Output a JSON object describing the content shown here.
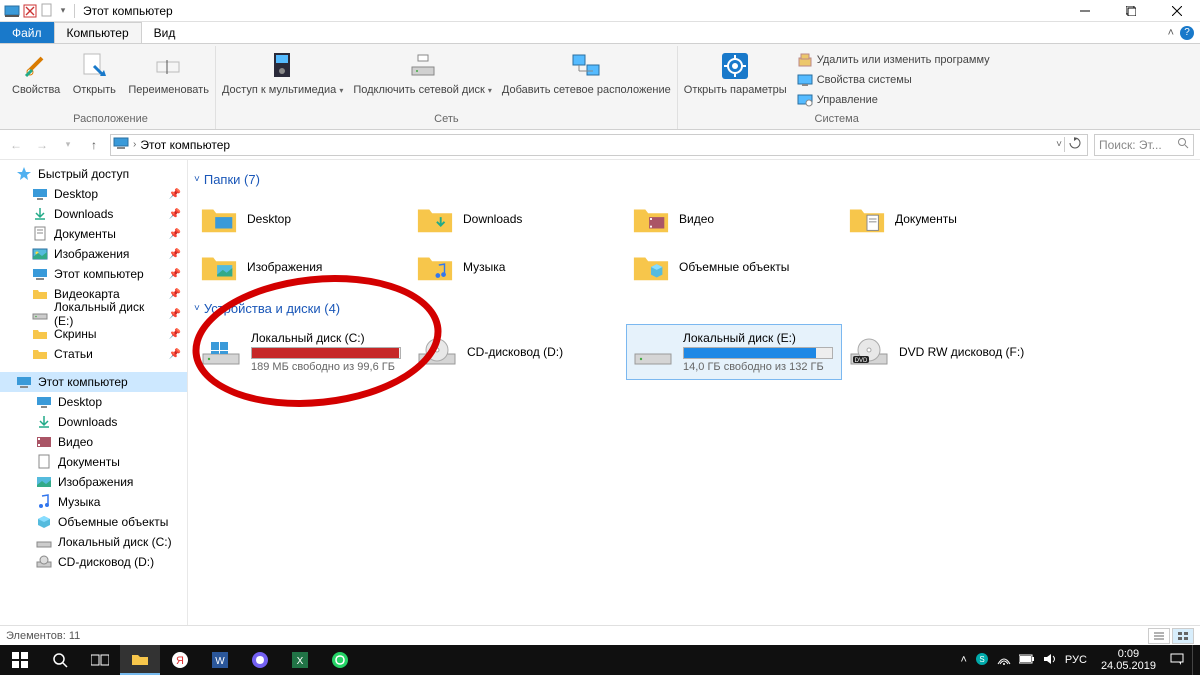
{
  "title": "Этот компьютер",
  "ribbon_tabs": {
    "file": "Файл",
    "computer": "Компьютер",
    "view": "Вид"
  },
  "ribbon": {
    "group1_label": "Расположение",
    "btn_properties": "Свойства",
    "btn_open": "Открыть",
    "btn_rename": "Переименовать",
    "group2_label": "Сеть",
    "btn_media": "Доступ к\nмультимедиа",
    "btn_mapdrive": "Подключить\nсетевой диск",
    "btn_addloc": "Добавить сетевое\nрасположение",
    "group3_label": "Система",
    "btn_settings": "Открыть\nпараметры",
    "btn_uninstall": "Удалить или изменить программу",
    "btn_sysprops": "Свойства системы",
    "btn_manage": "Управление"
  },
  "breadcrumb": "Этот компьютер",
  "search_placeholder": "Поиск: Эт...",
  "sidebar": {
    "quick": "Быстрый доступ",
    "desktop": "Desktop",
    "downloads": "Downloads",
    "documents": "Документы",
    "pictures": "Изображения",
    "this_pc": "Этот компьютер",
    "videocard": "Видеокарта",
    "local_e": "Локальный диск (E:)",
    "screens": "Скрины",
    "articles": "Статьи",
    "this_pc2": "Этот компьютер",
    "desktop2": "Desktop",
    "downloads2": "Downloads",
    "video": "Видео",
    "documents2": "Документы",
    "pictures2": "Изображения",
    "music": "Музыка",
    "objects3d": "Объемные объекты",
    "local_c": "Локальный диск (C:)",
    "cd_d": "CD-дисковод (D:)"
  },
  "sections": {
    "folders_header": "Папки (7)",
    "drives_header": "Устройства и диски (4)"
  },
  "folders": {
    "desktop": "Desktop",
    "downloads": "Downloads",
    "video": "Видео",
    "documents": "Документы",
    "pictures": "Изображения",
    "music": "Музыка",
    "objects3d": "Объемные объекты"
  },
  "drives": {
    "c": {
      "name": "Локальный диск (C:)",
      "free": "189 МБ свободно из 99,6 ГБ",
      "fill_pct": 99,
      "color": "#c62828"
    },
    "d": {
      "name": "CD-дисковод (D:)"
    },
    "e": {
      "name": "Локальный диск (E:)",
      "free": "14,0 ГБ свободно из 132 ГБ",
      "fill_pct": 89,
      "color": "#1e88e5"
    },
    "f": {
      "name": "DVD RW дисковод (F:)"
    }
  },
  "statusbar": {
    "count": "Элементов: 11"
  },
  "tray": {
    "lang": "РУС",
    "time": "0:09",
    "date": "24.05.2019"
  }
}
